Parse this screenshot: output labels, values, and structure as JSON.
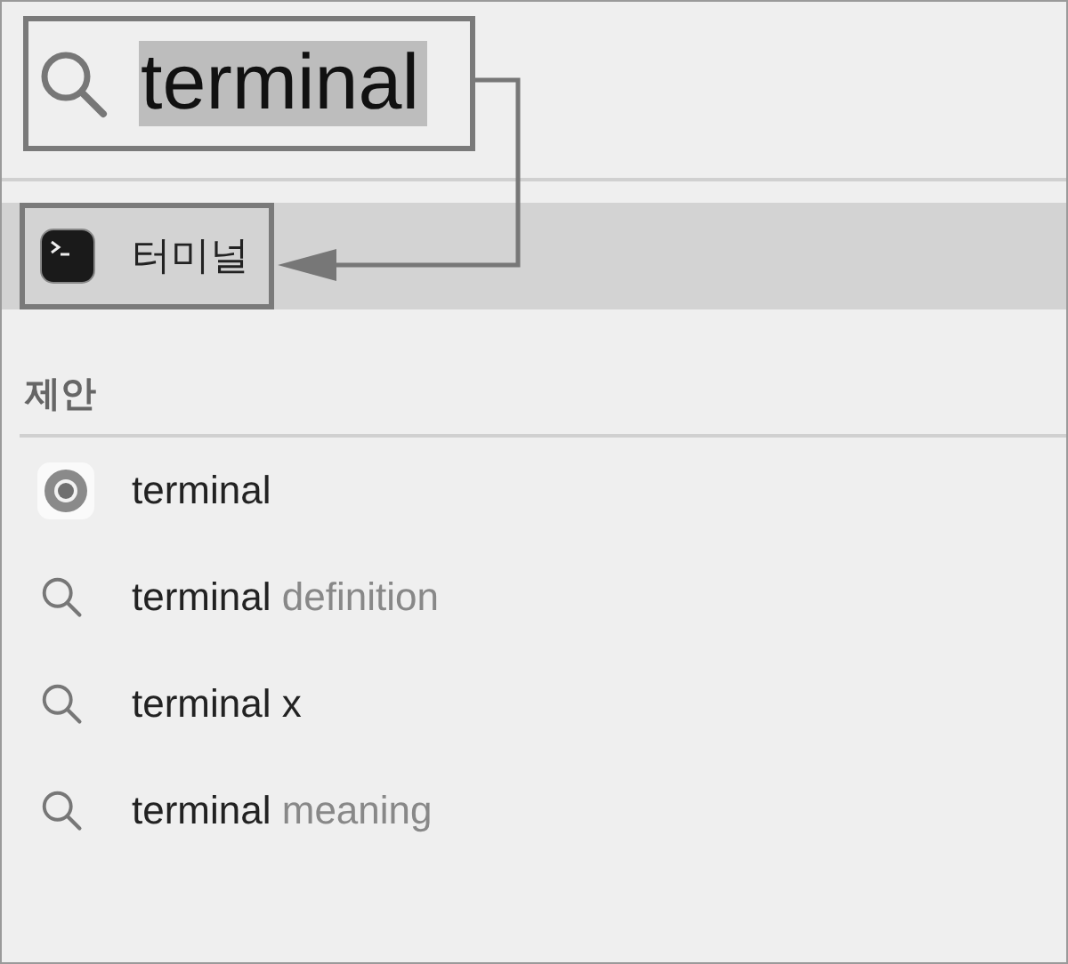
{
  "search": {
    "value": "terminal",
    "text_selected": true
  },
  "top_hit": {
    "label": "터미널",
    "selected": true
  },
  "section_title": "제안",
  "suggestions": [
    {
      "kind": "app",
      "query": "terminal"
    },
    {
      "kind": "search",
      "query": "terminal",
      "completion": "definition"
    },
    {
      "kind": "search",
      "query": "terminal x"
    },
    {
      "kind": "search",
      "query": "terminal",
      "completion": "meaning"
    }
  ]
}
